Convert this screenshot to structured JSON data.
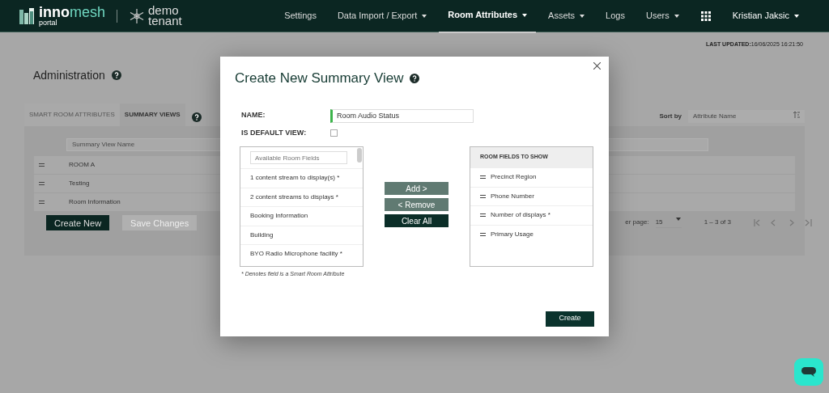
{
  "brand": {
    "name_bold": "inno",
    "name_light": "mesh",
    "sub": "portal",
    "tenant_line1": "demo",
    "tenant_line2": "tenant"
  },
  "nav": [
    {
      "label": "Settings",
      "dropdown": false,
      "selected": false
    },
    {
      "label": "Data Import / Export",
      "dropdown": true,
      "selected": false
    },
    {
      "label": "Room Attributes",
      "dropdown": true,
      "selected": true
    },
    {
      "label": "Assets",
      "dropdown": true,
      "selected": false
    },
    {
      "label": "Logs",
      "dropdown": false,
      "selected": false
    },
    {
      "label": "Users",
      "dropdown": true,
      "selected": false
    }
  ],
  "user": "Kristian Jaksic",
  "last_updated": {
    "label": "LAST UPDATED:",
    "value": "16/06/2025 16:21:50"
  },
  "page_title": "Administration",
  "tabs": [
    {
      "label": "SMART ROOM ATTRIBUTES",
      "selected": false
    },
    {
      "label": "SUMMARY VIEWS",
      "selected": true
    }
  ],
  "sort": {
    "label": "Sort by",
    "value": "Attribute Name"
  },
  "filter": {
    "placeholder": "Summary View Name"
  },
  "views": [
    "ROOM A",
    "Testing",
    "Room Information"
  ],
  "buttons": [
    {
      "label": "Create New",
      "disabled": false
    },
    {
      "label": "Save Changes",
      "disabled": true
    }
  ],
  "pagination": {
    "per_page_label": "er page:",
    "per_page": "15",
    "range": "1 – 3 of 3"
  },
  "modal": {
    "title": "Create New Summary View",
    "name_label": "NAME:",
    "name_value": "Room Audio Status",
    "default_label": "IS DEFAULT VIEW:",
    "is_default": false,
    "available": {
      "placeholder": "Available Room Fields",
      "items": [
        "1 content stream to display(s) *",
        "2 content streams to displays *",
        "Booking Information",
        "Building",
        "BYO Radio Microphone facility *"
      ]
    },
    "actions": [
      {
        "label": "Add >",
        "kind": "muted"
      },
      {
        "label": "< Remove",
        "kind": "muted"
      },
      {
        "label": "Clear All",
        "kind": "dark"
      }
    ],
    "selected_fields": {
      "header": "ROOM FIELDS TO SHOW",
      "items": [
        "Precinct Region",
        "Phone Number",
        "Number of displays *",
        "Primary Usage"
      ]
    },
    "footnote": "* Denotes field is a Smart Room Attribute",
    "submit": "Create"
  }
}
